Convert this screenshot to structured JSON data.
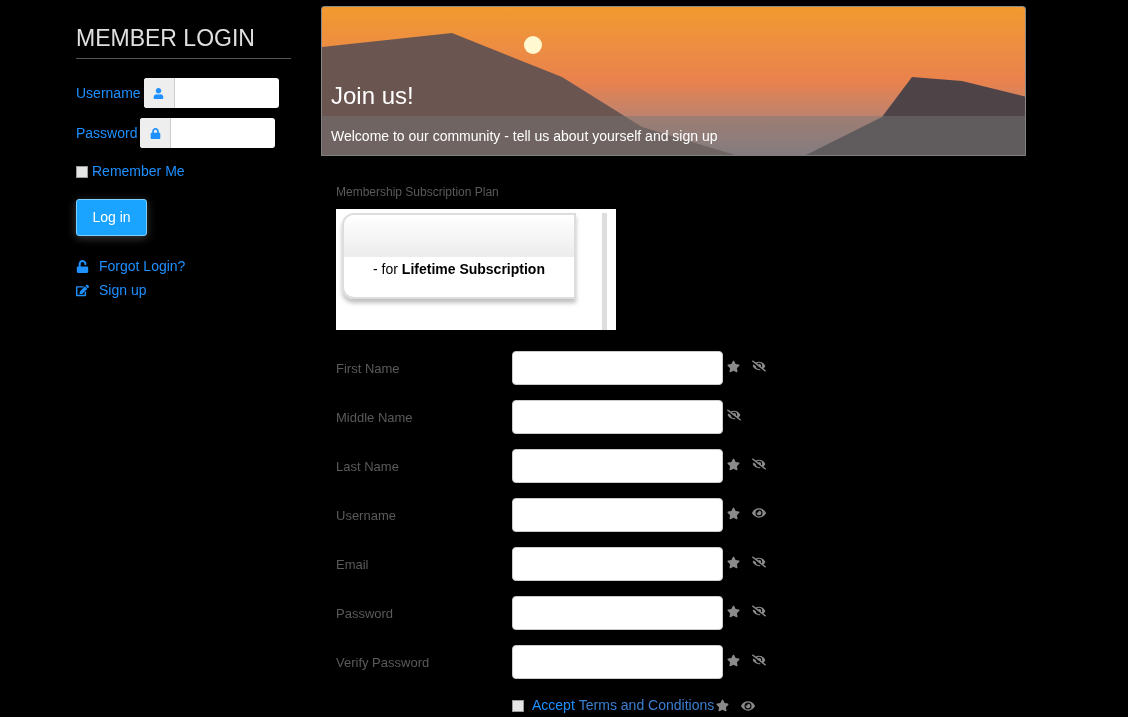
{
  "login": {
    "title": "MEMBER LOGIN",
    "fields": [
      {
        "label": "Username",
        "kind": "user"
      },
      {
        "label": "Password",
        "kind": "lock"
      }
    ],
    "remember": {
      "label": "Remember Me",
      "checked": false
    },
    "button": "Log in",
    "links": [
      {
        "label": "Forgot Login?",
        "kind": "unlock"
      },
      {
        "label": "Sign up",
        "kind": "edit"
      }
    ]
  },
  "banner": {
    "title": "Join us!",
    "subtitle": "Welcome to our community - tell us about yourself and sign up"
  },
  "plan": {
    "label": "Membership Subscription Plan",
    "option": "- for **Lifetime Subscription**"
  },
  "fields": [
    {
      "label": "First Name",
      "required": true,
      "visible": false
    },
    {
      "label": "Middle Name",
      "required": false,
      "visible": false
    },
    {
      "label": "Last Name",
      "required": true,
      "visible": false
    },
    {
      "label": "Username",
      "required": true,
      "visible": true
    },
    {
      "label": "Email",
      "required": true,
      "visible": false
    },
    {
      "label": "Password",
      "required": true,
      "visible": false
    },
    {
      "label": "Verify Password",
      "required": true,
      "visible": false
    }
  ],
  "terms": {
    "accept": "Accept",
    "link": "Terms and Conditions",
    "checked": false,
    "required": true,
    "visible": true
  }
}
